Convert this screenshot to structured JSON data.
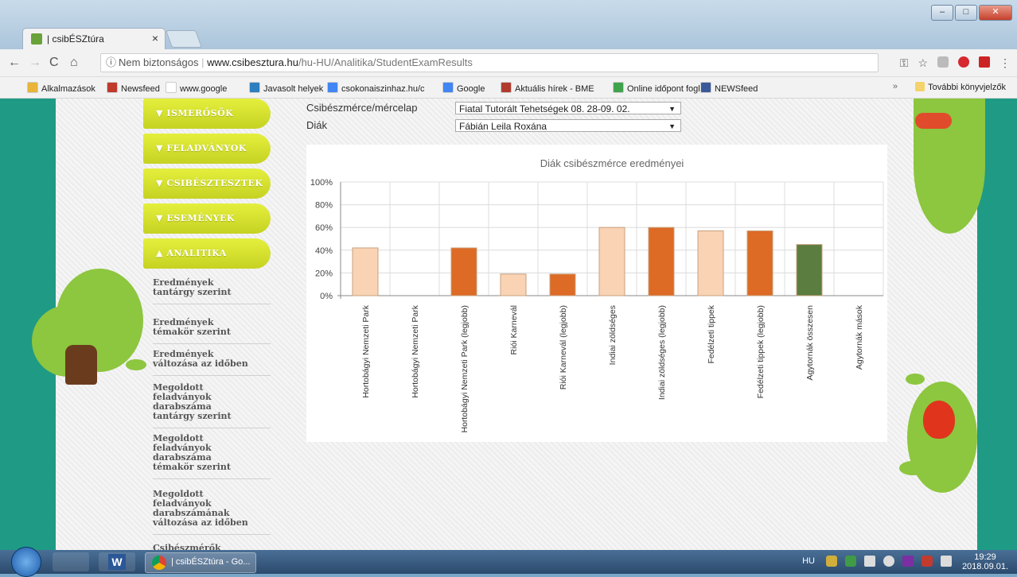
{
  "window": {
    "tab_title": "| csibÉSZtúra",
    "tab_close": "×",
    "min": "–",
    "max": "□",
    "close": "✕"
  },
  "browser": {
    "security_label": "Nem biztonságos",
    "url_host": "www.csibesztura.hu",
    "url_path": "/hu-HU/Analitika/StudentExamResults",
    "back": "←",
    "forward": "→",
    "reload": "C",
    "home": "⌂",
    "info_icon": "ⓘ",
    "key_icon": "⚿",
    "star_icon": "☆",
    "menu_icon": "⋮"
  },
  "bookmarks": [
    {
      "label": "Alkalmazások",
      "color": "#e8b43a"
    },
    {
      "label": "Newsfeed",
      "color": "#c0392b"
    },
    {
      "label": "www.google",
      "color": "#ffffff"
    },
    {
      "label": "Javasolt helyek",
      "color": "#2d7fc0"
    },
    {
      "label": "csokonaiszinhaz.hu/c",
      "color": "#4285f4"
    },
    {
      "label": "Google",
      "color": "#4285f4"
    },
    {
      "label": "Aktuális hírek - BME",
      "color": "#b03a2e"
    },
    {
      "label": "Online időpont fogla",
      "color": "#3fa34d"
    },
    {
      "label": "NEWSfeed",
      "color": "#3b5998"
    }
  ],
  "bookmarks_overflow": "»",
  "bookmarks_other": "További könyvjelzők",
  "sidebar": {
    "nav": [
      {
        "label": "ISMERŐSÖK",
        "arrow": "▼"
      },
      {
        "label": "FELADVÁNYOK",
        "arrow": "▼"
      },
      {
        "label": "CSIBÉSZTESZTEK",
        "arrow": "▼"
      },
      {
        "label": "ESEMÉNYEK",
        "arrow": "▼"
      },
      {
        "label": "ANALITIKA",
        "arrow": "▲"
      }
    ],
    "sub": [
      [
        "Eredmények",
        "tantárgy szerint"
      ],
      [
        "Eredmények",
        "témakör szerint"
      ],
      [
        "Eredmények",
        "változása az időben"
      ],
      [
        "Megoldott",
        "feladványok",
        "darabszáma",
        "tantárgy szerint"
      ],
      [
        "Megoldott",
        "feladványok",
        "darabszáma",
        "témakör szerint"
      ],
      [
        "Megoldott",
        "feladványok",
        "darabszámának",
        "változása az időben"
      ],
      [
        "Csibészmérők"
      ]
    ]
  },
  "form": {
    "exam_label": "Csibészmérce/mércelap",
    "exam_value": "Fiatal Tutorált Tehetségek 08. 28-09. 02.",
    "student_label": "Diák",
    "student_value": "Fábián Leila Roxána",
    "dropdown_arrow": "▼"
  },
  "chart_data": {
    "type": "bar",
    "title": "Diák csibészmérce eredményei",
    "categories": [
      "Hortobágyi Nemzeti Park",
      "Hortobágyi Nemzeti Park",
      "Hortobágyi Nemzeti Park (legjobb)",
      "Riói Karnevál",
      "Riói Karnevál (legjobb)",
      "Indiai zöldséges",
      "Indiai zöldséges (legjobb)",
      "Fedélzeti tippek",
      "Fedélzeti tippek (legjobb)",
      "Agytornák összesen",
      "Agytornák mások"
    ],
    "values": [
      42,
      0,
      42,
      19,
      19,
      60,
      60,
      57,
      57,
      45,
      0
    ],
    "colors": [
      "#f9d3b4",
      "#f9d3b4",
      "#dd6a25",
      "#f9d3b4",
      "#dd6a25",
      "#f9d3b4",
      "#dd6a25",
      "#f9d3b4",
      "#dd6a25",
      "#5b7d3f",
      "#5b7d3f"
    ],
    "yticks": [
      "0%",
      "20%",
      "40%",
      "60%",
      "80%",
      "100%"
    ],
    "ylim": [
      0,
      100
    ],
    "grid": true
  },
  "taskbar": {
    "chrome_label": "| csibÉSZtúra - Go...",
    "lang": "HU",
    "time": "19:29",
    "date": "2018.09.01."
  }
}
